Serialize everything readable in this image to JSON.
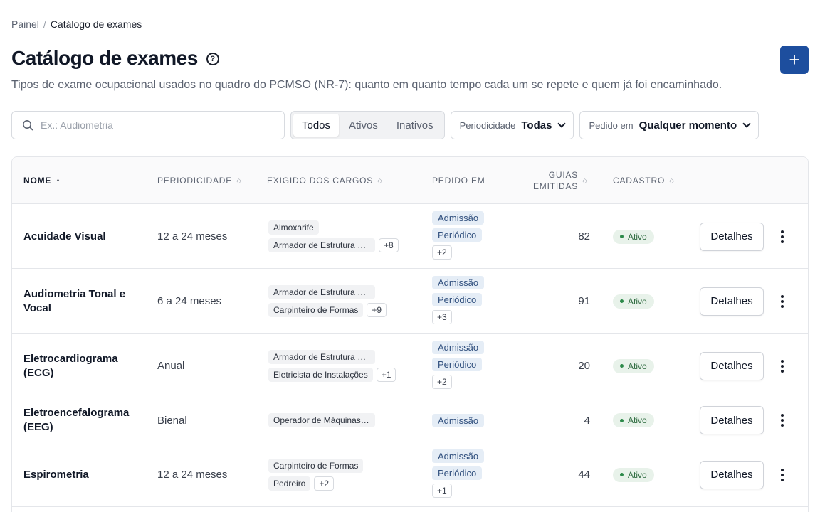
{
  "breadcrumb": {
    "parent": "Painel",
    "separator": "/",
    "current": "Catálogo de exames"
  },
  "header": {
    "title": "Catálogo de exames",
    "help_icon": "question-circle-icon",
    "subtitle": "Tipos de exame ocupacional usados no quadro do PCMSO (NR-7): quanto em quanto tempo cada um se repete e quem já foi encaminhado.",
    "add_icon": "plus-icon",
    "add_symbol": "+"
  },
  "filters": {
    "search_placeholder": "Ex.: Audiometria",
    "segments": [
      "Todos",
      "Ativos",
      "Inativos"
    ],
    "active_segment": "Todos",
    "periodicity": {
      "label": "Periodicidade",
      "value": "Todas"
    },
    "ordered": {
      "label": "Pedido em",
      "value": "Qualquer momento"
    }
  },
  "table": {
    "columns": {
      "name": "Nome",
      "name_sort": "↑",
      "periodicity": "Periodicidade",
      "roles": "Exigido dos cargos",
      "ordered": "Pedido em",
      "guides_line1": "Guias",
      "guides_line2": "emitidas",
      "registry": "Cadastro",
      "sort_symbol": "◇"
    },
    "rows": [
      {
        "name": "Acuidade Visual",
        "periodicity": "12 a 24 meses",
        "roles": [
          "Almoxarife",
          "Armador de Estrutura de Concreto"
        ],
        "roles_more": "+8",
        "ordered": [
          "Admissão",
          "Periódico"
        ],
        "ordered_more": "+2",
        "guides": "82",
        "status": "Ativo",
        "action": "Detalhes"
      },
      {
        "name": "Audiometria Tonal e Vocal",
        "periodicity": "6 a 24 meses",
        "roles": [
          "Armador de Estrutura de Concreto",
          "Carpinteiro de Formas"
        ],
        "roles_more": "+9",
        "ordered": [
          "Admissão",
          "Periódico"
        ],
        "ordered_more": "+3",
        "guides": "91",
        "status": "Ativo",
        "action": "Detalhes"
      },
      {
        "name": "Eletrocardiograma (ECG)",
        "periodicity": "Anual",
        "roles": [
          "Armador de Estrutura de Concreto",
          "Eletricista de Instalações"
        ],
        "roles_more": "+1",
        "ordered": [
          "Admissão",
          "Periódico"
        ],
        "ordered_more": "+2",
        "guides": "20",
        "status": "Ativo",
        "action": "Detalhes"
      },
      {
        "name": "Eletroencefalograma (EEG)",
        "periodicity": "Bienal",
        "roles": [
          "Operador de Máquinas Pesadas"
        ],
        "roles_more": "",
        "ordered": [
          "Admissão"
        ],
        "ordered_more": "",
        "guides": "4",
        "status": "Ativo",
        "action": "Detalhes"
      },
      {
        "name": "Espirometria",
        "periodicity": "12 a 24 meses",
        "roles": [
          "Carpinteiro de Formas",
          "Pedreiro"
        ],
        "roles_more": "+2",
        "ordered": [
          "Admissão",
          "Periódico"
        ],
        "ordered_more": "+1",
        "guides": "44",
        "status": "Ativo",
        "action": "Detalhes"
      }
    ]
  }
}
